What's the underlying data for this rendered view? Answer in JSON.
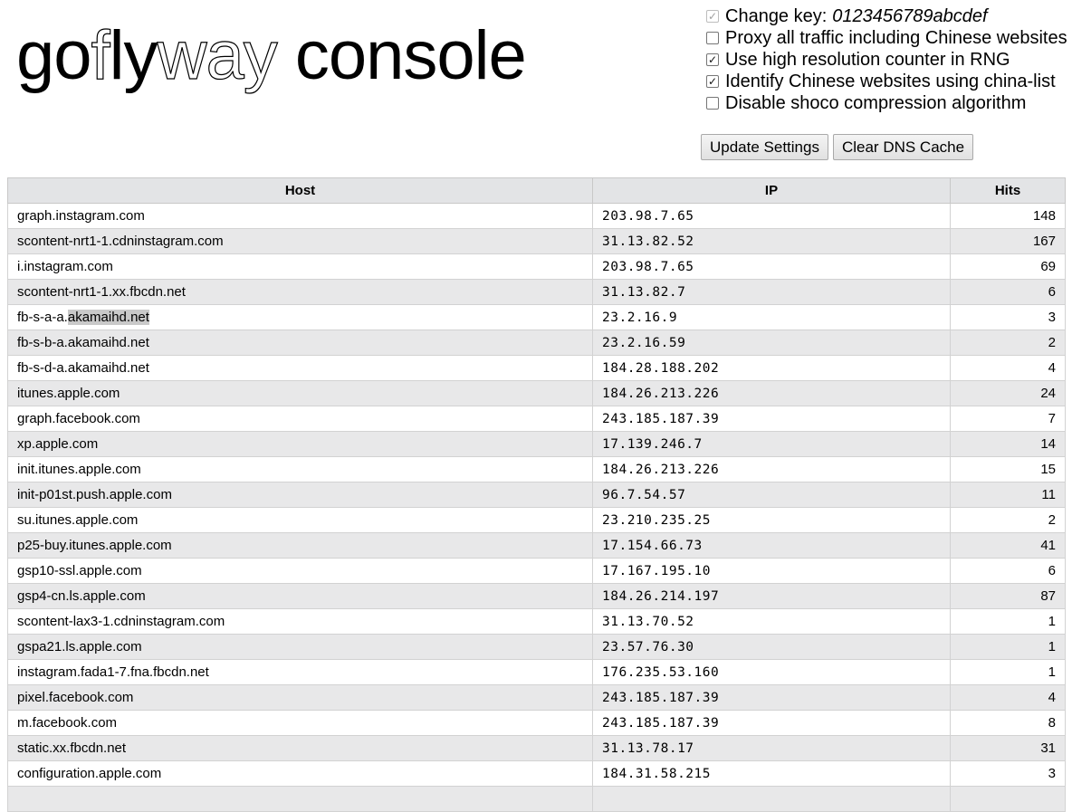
{
  "logo": {
    "part1": "go",
    "part2": "f",
    "part3": "ly",
    "part4": "w",
    "part5": "ay",
    "part6": " console"
  },
  "settings": [
    {
      "id": "change-key",
      "label": "Change key:",
      "value": "0123456789abcdef",
      "checked": true,
      "disabled": true
    },
    {
      "id": "proxy-all",
      "label": "Proxy all traffic including Chinese websites",
      "checked": false
    },
    {
      "id": "high-res-counter",
      "label": "Use high resolution counter in RNG",
      "checked": true
    },
    {
      "id": "china-list",
      "label": "Identify Chinese websites using china-list",
      "checked": true
    },
    {
      "id": "disable-shoco",
      "label": "Disable shoco compression algorithm",
      "checked": false
    }
  ],
  "buttons": {
    "update": "Update Settings",
    "clear_dns": "Clear DNS Cache"
  },
  "table": {
    "headers": [
      "Host",
      "IP",
      "Hits"
    ],
    "rows": [
      {
        "host": "graph.instagram.com",
        "ip": "203.98.7.65",
        "hits": "148"
      },
      {
        "host": "scontent-nrt1-1.cdninstagram.com",
        "ip": "31.13.82.52",
        "hits": "167"
      },
      {
        "host": "i.instagram.com",
        "ip": "203.98.7.65",
        "hits": "69"
      },
      {
        "host": "scontent-nrt1-1.xx.fbcdn.net",
        "ip": "31.13.82.7",
        "hits": "6"
      },
      {
        "host": "fb-s-a-a.akamaihd.net",
        "host_pre": "fb-s-a-a.",
        "host_sel": "akamaihd.net",
        "ip": "23.2.16.9",
        "hits": "3"
      },
      {
        "host": "fb-s-b-a.akamaihd.net",
        "ip": "23.2.16.59",
        "hits": "2"
      },
      {
        "host": "fb-s-d-a.akamaihd.net",
        "ip": "184.28.188.202",
        "hits": "4"
      },
      {
        "host": "itunes.apple.com",
        "ip": "184.26.213.226",
        "hits": "24"
      },
      {
        "host": "graph.facebook.com",
        "ip": "243.185.187.39",
        "hits": "7"
      },
      {
        "host": "xp.apple.com",
        "ip": "17.139.246.7",
        "hits": "14"
      },
      {
        "host": "init.itunes.apple.com",
        "ip": "184.26.213.226",
        "hits": "15"
      },
      {
        "host": "init-p01st.push.apple.com",
        "ip": "96.7.54.57",
        "hits": "11"
      },
      {
        "host": "su.itunes.apple.com",
        "ip": "23.210.235.25",
        "hits": "2"
      },
      {
        "host": "p25-buy.itunes.apple.com",
        "ip": "17.154.66.73",
        "hits": "41"
      },
      {
        "host": "gsp10-ssl.apple.com",
        "ip": "17.167.195.10",
        "hits": "6"
      },
      {
        "host": "gsp4-cn.ls.apple.com",
        "ip": "184.26.214.197",
        "hits": "87"
      },
      {
        "host": "scontent-lax3-1.cdninstagram.com",
        "ip": "31.13.70.52",
        "hits": "1"
      },
      {
        "host": "gspa21.ls.apple.com",
        "ip": "23.57.76.30",
        "hits": "1"
      },
      {
        "host": "instagram.fada1-7.fna.fbcdn.net",
        "ip": "176.235.53.160",
        "hits": "1"
      },
      {
        "host": "pixel.facebook.com",
        "ip": "243.185.187.39",
        "hits": "4"
      },
      {
        "host": "m.facebook.com",
        "ip": "243.185.187.39",
        "hits": "8"
      },
      {
        "host": "static.xx.fbcdn.net",
        "ip": "31.13.78.17",
        "hits": "31"
      },
      {
        "host": "configuration.apple.com",
        "ip": "184.31.58.215",
        "hits": "3"
      },
      {
        "host": "",
        "ip": "",
        "hits": ""
      }
    ]
  }
}
